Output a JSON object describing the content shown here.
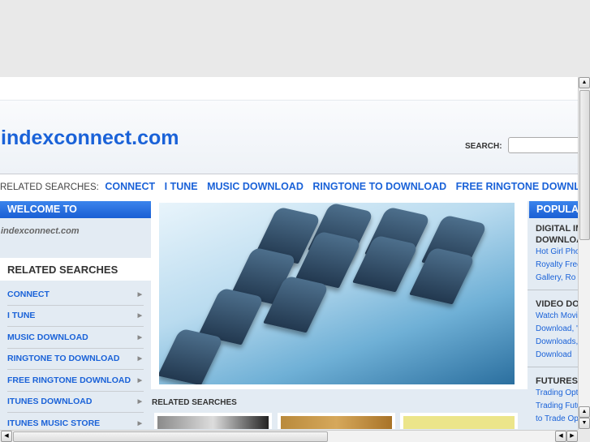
{
  "site": {
    "logo": "indexconnect.com",
    "search_label": "SEARCH:",
    "search_value": ""
  },
  "related_bar": {
    "label": "RELATED SEARCHES:",
    "links": [
      "CONNECT",
      "I TUNE",
      "MUSIC DOWNLOAD",
      "RINGTONE TO DOWNLOAD",
      "FREE RINGTONE DOWNL"
    ]
  },
  "left": {
    "welcome": "WELCOME TO",
    "welcome_sub": "indexconnect.com",
    "related_title": "RELATED SEARCHES",
    "items": [
      "CONNECT",
      "I TUNE",
      "MUSIC DOWNLOAD",
      "RINGTONE TO DOWNLOAD",
      "FREE RINGTONE DOWNLOAD",
      "ITUNES DOWNLOAD",
      "ITUNES MUSIC STORE"
    ]
  },
  "middle": {
    "related_title": "RELATED SEARCHES"
  },
  "right": {
    "title": "POPULA",
    "sections": [
      {
        "heading": [
          "DIGITAL IM",
          "DOWNLOA"
        ],
        "links": [
          "Hot Girl Pho",
          "Royalty Free",
          "Gallery, Ro"
        ]
      },
      {
        "heading": [
          "VIDEO DO"
        ],
        "links": [
          "Watch Movi",
          "Download, '",
          "Downloads,",
          "Download"
        ]
      },
      {
        "heading": [
          "FUTURES"
        ],
        "links": [
          "Trading Opt",
          "Trading Futu",
          "to Trade Op"
        ]
      }
    ]
  },
  "colors": {
    "accent": "#1a62d8",
    "panel": "#e3ebf3"
  }
}
